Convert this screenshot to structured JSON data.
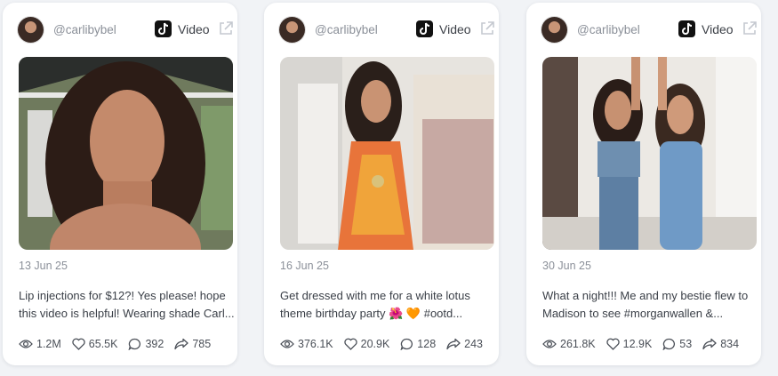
{
  "cards": [
    {
      "handle": "@carlibybel",
      "type": "Video",
      "date": "13 Jun 25",
      "caption": "Lip injections for $12?! Yes please! hope this video is helpful! Wearing shade Carl...",
      "views": "1.2M",
      "likes": "65.5K",
      "comments": "392",
      "shares": "785"
    },
    {
      "handle": "@carlibybel",
      "type": "Video",
      "date": "16 Jun 25",
      "caption": "Get dressed with me for a white lotus theme birthday party 🌺 🧡 #ootd...",
      "views": "376.1K",
      "likes": "20.9K",
      "comments": "128",
      "shares": "243"
    },
    {
      "handle": "@carlibybel",
      "type": "Video",
      "date": "30 Jun 25",
      "caption": "What a night!!! Me and my bestie flew to Madison to see #morganwallen &...",
      "views": "261.8K",
      "likes": "12.9K",
      "comments": "53",
      "shares": "834"
    }
  ],
  "icons": {
    "platform": "tiktok-icon",
    "external": "external-link-icon",
    "views": "eye-icon",
    "likes": "heart-icon",
    "comments": "comment-icon",
    "shares": "share-icon"
  },
  "colors": {
    "background": "#f1f3f6",
    "card": "#ffffff",
    "muted_text": "#8a8f98",
    "body_text": "#3a3f47"
  }
}
